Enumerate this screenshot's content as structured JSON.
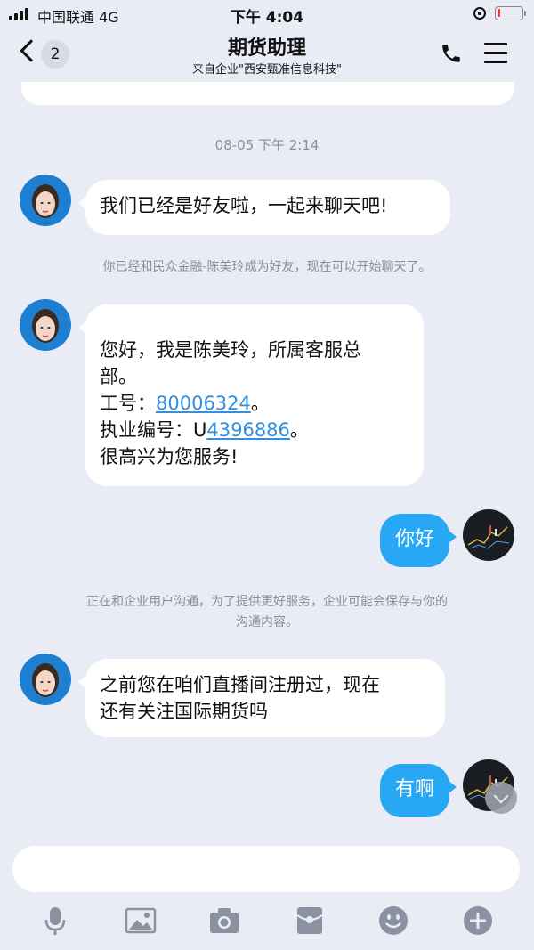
{
  "status": {
    "carrier": "中国联通  4G",
    "time": "下午 4:04",
    "battery_level": 0.12,
    "battery_color": "#e53935"
  },
  "header": {
    "back_badge": "2",
    "title": "期货助理",
    "subtitle": "来自企业\"西安甄准信息科技\"",
    "icons": [
      "back-chevron-icon",
      "phone-icon",
      "menu-icon"
    ]
  },
  "chat": {
    "timestamp": "08-05 下午 2:14",
    "messages": [
      {
        "side": "left",
        "text": "我们已经是好友啦，一起来聊天吧!"
      },
      {
        "side": "system",
        "text": "你已经和民众金融-陈美玲成为好友，现在可以开始聊天了。"
      },
      {
        "side": "left",
        "lines": {
          "l1": "您好，我是陈美玲，所属客服总",
          "l2": "部。",
          "l3_prefix": "工号：",
          "l3_link": "80006324",
          "l3_suffix": "。",
          "l4_prefix": "执业编号：U",
          "l4_link": "4396886",
          "l4_suffix": "。",
          "l5": "很高兴为您服务!"
        }
      },
      {
        "side": "right",
        "text": "你好"
      },
      {
        "side": "system",
        "line1": "正在和企业用户沟通，为了提供更好服务，企业可能会保存与你的",
        "line2": "沟通内容。"
      },
      {
        "side": "left",
        "line1": "之前您在咱们直播间注册过，现在",
        "line2": "还有关注国际期货吗"
      },
      {
        "side": "right",
        "text": "有啊"
      }
    ],
    "accent_color": "#28a8f4",
    "link_color": "#2f8fe0"
  },
  "composer": {
    "placeholder": "",
    "tools": [
      "microphone-icon",
      "image-icon",
      "camera-icon",
      "red-packet-icon",
      "emoji-icon",
      "plus-icon"
    ]
  }
}
